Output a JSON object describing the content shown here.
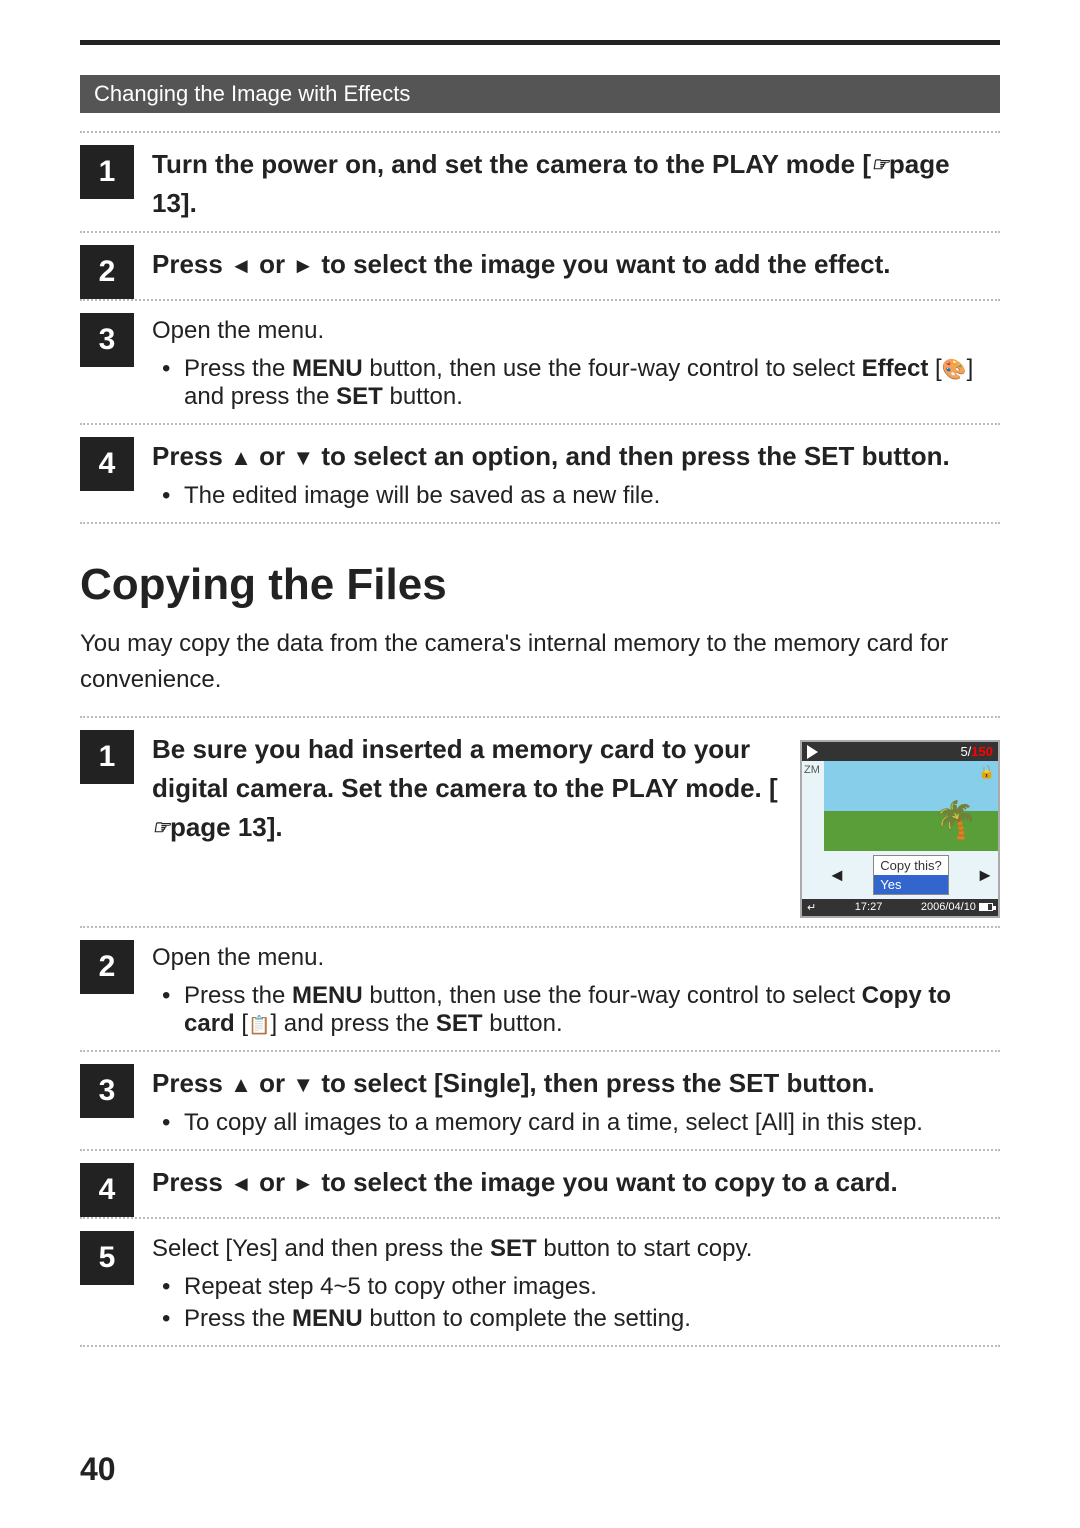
{
  "topLine": true,
  "section1": {
    "header": "Changing the Image with Effects",
    "steps": [
      {
        "num": "1",
        "text": "Turn the power on, and set the camera to the PLAY mode [",
        "textSuffix": "page 13].",
        "bold": true,
        "hasRef": true
      },
      {
        "num": "2",
        "text": "Press ",
        "arrowLeft": "◄",
        "or": "or",
        "arrowRight": "►",
        "textSuffix": " to select the image you want to add the effect.",
        "bold": true
      },
      {
        "num": "3",
        "text": "Open the menu.",
        "bold": false,
        "bullets": [
          "Press the MENU button, then use the four-way control to select Effect [effect-icon] and press the SET button."
        ]
      },
      {
        "num": "4",
        "text": "Press ",
        "arrowUp": "▲",
        "or": "or",
        "arrowDown": "▼",
        "textSuffix": " to select an option, and then press the SET button.",
        "bold": true,
        "bullets": [
          "The edited image will be saved as a new file."
        ]
      }
    ]
  },
  "section2": {
    "title": "Copying the Files",
    "intro": "You may copy the data from the camera's internal memory to the memory card for convenience.",
    "steps": [
      {
        "num": "1",
        "text": "Be sure you had inserted a memory card to your digital camera. Set the camera to the PLAY mode. [",
        "textSuffix": "page 13].",
        "bold": true,
        "hasImage": true
      },
      {
        "num": "2",
        "text": "Open the menu.",
        "bold": false,
        "bullets": [
          "Press the MENU button, then use the four-way control to select Copy to card [copy-icon] and press the SET button."
        ]
      },
      {
        "num": "3",
        "text": "Press ",
        "arrowUp": "▲",
        "or": "or",
        "arrowDown": "▼",
        "textSuffix": " to select [Single], then press the SET button.",
        "bold": true,
        "bullets": [
          "To copy all images to a memory card in a time, select [All] in this step."
        ]
      },
      {
        "num": "4",
        "text": "Press ",
        "arrowLeft": "◄",
        "or": "or",
        "arrowRight": "►",
        "textSuffix": " to select the image you want to copy to a card.",
        "bold": true
      },
      {
        "num": "5",
        "text": "Select [Yes] and then press the SET button to start copy.",
        "bold": false,
        "bullets": [
          "Repeat step 4~5 to copy other images.",
          "Press the MENU button to complete the setting."
        ]
      }
    ],
    "cameraScreen": {
      "counter": "5/150",
      "time": "17:27",
      "date": "2006/04/10",
      "menuLabel": "Copy this?",
      "menuYes": "Yes",
      "menuBack": "↵"
    }
  },
  "pageNumber": "40"
}
